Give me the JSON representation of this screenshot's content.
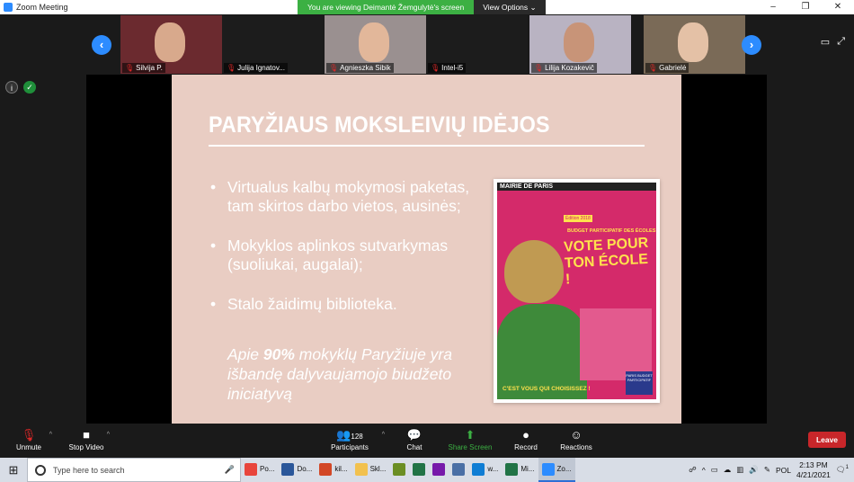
{
  "window": {
    "title": "Zoom Meeting",
    "controls": {
      "minimize": "–",
      "restore": "❐",
      "close": "✕"
    }
  },
  "banner": {
    "message": "You are viewing Deimantė Žemgulytė's screen",
    "view_options": "View Options ⌄"
  },
  "gallery": {
    "prev": "‹",
    "next": "›",
    "participants": [
      {
        "name": "Silvija P.",
        "bg": "#6b2a2f",
        "face": "#d8a98c"
      },
      {
        "name": "Julija Ignatov...",
        "bg": "#1c1c1c",
        "face": ""
      },
      {
        "name": "Agnieszka Sibik",
        "bg": "#9a9090",
        "face": "#e2b79a"
      },
      {
        "name": "Intel-i5",
        "bg": "#1c1c1c",
        "face": ""
      },
      {
        "name": "Lilija Kozakevič",
        "bg": "#b9b3c2",
        "face": "#c89478"
      },
      {
        "name": "Gabrielė",
        "bg": "#7a6a57",
        "face": "#e4c1a6"
      }
    ]
  },
  "slide": {
    "title": "PARYŽIAUS MOKSLEIVIŲ IDĖJOS",
    "bullets": [
      "Virtualus kalbų mokymosi paketas, tam skirtos darbo vietos, ausinės;",
      "Mokyklos aplinkos sutvarkymas (suoliukai, augalai);",
      "Stalo žaidimų biblioteka."
    ],
    "note_before": "Apie ",
    "note_bold": "90%",
    "note_after": " mokyklų Paryžiuje yra išbandę dalyvaujamojo biudžeto iniciatyvą",
    "poster": {
      "header": "MAIRIE DE PARIS",
      "tag": "Édition 2018",
      "subtitle": "BUDGET PARTICIPATIF DES ÉCOLES",
      "headline": "VOTE POUR TON ÉCOLE !",
      "footer": "C'EST VOUS QUI CHOISISSEZ !",
      "logo": "PARIS BUDGET PARTICIPATIF"
    }
  },
  "controls": {
    "unmute": "Unmute",
    "stop_video": "Stop Video",
    "participants": "Participants",
    "participant_count": "128",
    "chat": "Chat",
    "share_screen": "Share Screen",
    "record": "Record",
    "reactions": "Reactions",
    "leave": "Leave"
  },
  "taskbar": {
    "search_placeholder": "Type here to search",
    "apps": [
      {
        "label": "Po...",
        "color": "#e8453c"
      },
      {
        "label": "Do...",
        "color": "#2b579a"
      },
      {
        "label": "kil...",
        "color": "#d24726"
      },
      {
        "label": "Skl...",
        "color": "#f2c14e"
      },
      {
        "label": "",
        "color": "#6b8e23"
      },
      {
        "label": "",
        "color": "#217346"
      },
      {
        "label": "",
        "color": "#7719aa"
      },
      {
        "label": "",
        "color": "#4a6fa5"
      },
      {
        "label": "w...",
        "color": "#0f7dd4"
      },
      {
        "label": "Mi...",
        "color": "#217346"
      },
      {
        "label": "Zo...",
        "color": "#2d8cff"
      }
    ],
    "language": "POL",
    "time": "2:13 PM",
    "date": "4/21/2021",
    "notification_count": "1"
  }
}
